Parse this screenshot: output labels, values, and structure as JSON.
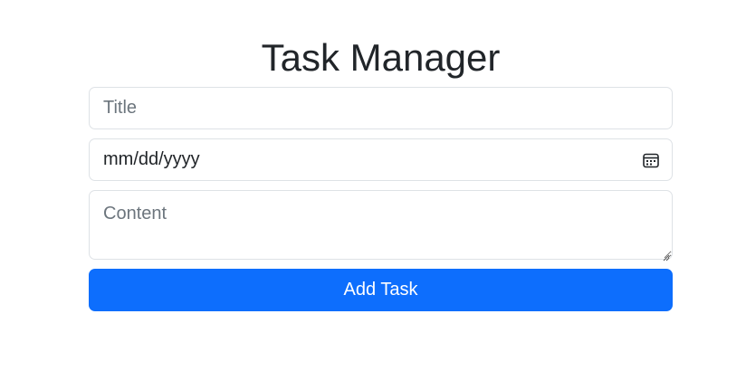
{
  "header": {
    "title": "Task Manager"
  },
  "form": {
    "title_placeholder": "Title",
    "title_value": "",
    "date_display": "mm/dd/yyyy",
    "date_icon": "calendar-icon",
    "content_placeholder": "Content",
    "content_value": "",
    "submit_label": "Add Task"
  },
  "colors": {
    "primary": "#0d6efd",
    "border": "#dee2e6",
    "placeholder": "#6c757d",
    "text": "#212529"
  }
}
